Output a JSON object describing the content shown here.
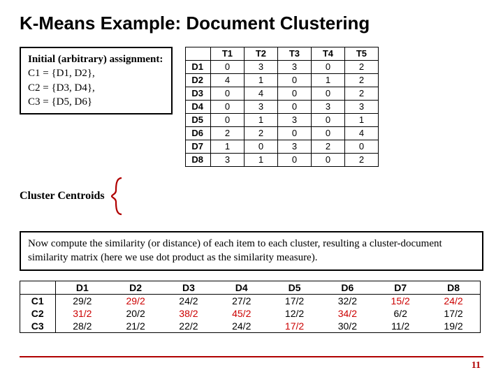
{
  "title": "K-Means Example: Document Clustering",
  "assignment": {
    "header": "Initial (arbitrary) assignment:",
    "lines": [
      "C1 = {D1, D2},",
      "C2 = {D3, D4},",
      "C3 = {D5, D6}"
    ]
  },
  "doc_table": {
    "col_headers": [
      "T1",
      "T2",
      "T3",
      "T4",
      "T5"
    ],
    "rows": [
      {
        "label": "D1",
        "cells": [
          "0",
          "3",
          "3",
          "0",
          "2"
        ]
      },
      {
        "label": "D2",
        "cells": [
          "4",
          "1",
          "0",
          "1",
          "2"
        ]
      },
      {
        "label": "D3",
        "cells": [
          "0",
          "4",
          "0",
          "0",
          "2"
        ]
      },
      {
        "label": "D4",
        "cells": [
          "0",
          "3",
          "0",
          "3",
          "3"
        ]
      },
      {
        "label": "D5",
        "cells": [
          "0",
          "1",
          "3",
          "0",
          "1"
        ]
      },
      {
        "label": "D6",
        "cells": [
          "2",
          "2",
          "0",
          "0",
          "4"
        ]
      },
      {
        "label": "D7",
        "cells": [
          "1",
          "0",
          "3",
          "2",
          "0"
        ]
      },
      {
        "label": "D8",
        "cells": [
          "3",
          "1",
          "0",
          "0",
          "2"
        ]
      }
    ]
  },
  "centroid_label": "Cluster Centroids",
  "note": "Now compute the similarity (or distance) of each item to each cluster, resulting a cluster-document similarity matrix (here we use dot product as the similarity measure).",
  "sim_table": {
    "col_headers": [
      "D1",
      "D2",
      "D3",
      "D4",
      "D5",
      "D6",
      "D7",
      "D8"
    ],
    "rows": [
      {
        "label": "C1",
        "cells": [
          {
            "v": "29/2",
            "red": false
          },
          {
            "v": "29/2",
            "red": true
          },
          {
            "v": "24/2",
            "red": false
          },
          {
            "v": "27/2",
            "red": false
          },
          {
            "v": "17/2",
            "red": false
          },
          {
            "v": "32/2",
            "red": false
          },
          {
            "v": "15/2",
            "red": true
          },
          {
            "v": "24/2",
            "red": true
          }
        ]
      },
      {
        "label": "C2",
        "cells": [
          {
            "v": "31/2",
            "red": true
          },
          {
            "v": "20/2",
            "red": false
          },
          {
            "v": "38/2",
            "red": true
          },
          {
            "v": "45/2",
            "red": true
          },
          {
            "v": "12/2",
            "red": false
          },
          {
            "v": "34/2",
            "red": true
          },
          {
            "v": "6/2",
            "red": false
          },
          {
            "v": "17/2",
            "red": false
          }
        ]
      },
      {
        "label": "C3",
        "cells": [
          {
            "v": "28/2",
            "red": false
          },
          {
            "v": "21/2",
            "red": false
          },
          {
            "v": "22/2",
            "red": false
          },
          {
            "v": "24/2",
            "red": false
          },
          {
            "v": "17/2",
            "red": true
          },
          {
            "v": "30/2",
            "red": false
          },
          {
            "v": "11/2",
            "red": false
          },
          {
            "v": "19/2",
            "red": false
          }
        ]
      }
    ]
  },
  "page_num": "11",
  "chart_data": [
    {
      "type": "table",
      "title": "Document-term matrix",
      "columns": [
        "T1",
        "T2",
        "T3",
        "T4",
        "T5"
      ],
      "rows": [
        "D1",
        "D2",
        "D3",
        "D4",
        "D5",
        "D6",
        "D7",
        "D8"
      ],
      "values": [
        [
          0,
          3,
          3,
          0,
          2
        ],
        [
          4,
          1,
          0,
          1,
          2
        ],
        [
          0,
          4,
          0,
          0,
          2
        ],
        [
          0,
          3,
          0,
          3,
          3
        ],
        [
          0,
          1,
          3,
          0,
          1
        ],
        [
          2,
          2,
          0,
          0,
          4
        ],
        [
          1,
          0,
          3,
          2,
          0
        ],
        [
          3,
          1,
          0,
          0,
          2
        ]
      ]
    },
    {
      "type": "table",
      "title": "Cluster-document similarity (dot product, halved)",
      "columns": [
        "D1",
        "D2",
        "D3",
        "D4",
        "D5",
        "D6",
        "D7",
        "D8"
      ],
      "rows": [
        "C1",
        "C2",
        "C3"
      ],
      "values_text": [
        [
          "29/2",
          "29/2",
          "24/2",
          "27/2",
          "17/2",
          "32/2",
          "15/2",
          "24/2"
        ],
        [
          "31/2",
          "20/2",
          "38/2",
          "45/2",
          "12/2",
          "34/2",
          "6/2",
          "17/2"
        ],
        [
          "28/2",
          "21/2",
          "22/2",
          "24/2",
          "17/2",
          "30/2",
          "11/2",
          "19/2"
        ]
      ],
      "highlight_red": [
        [
          false,
          true,
          false,
          false,
          false,
          false,
          true,
          true
        ],
        [
          true,
          false,
          true,
          true,
          false,
          true,
          false,
          false
        ],
        [
          false,
          false,
          false,
          false,
          true,
          false,
          false,
          false
        ]
      ]
    }
  ]
}
